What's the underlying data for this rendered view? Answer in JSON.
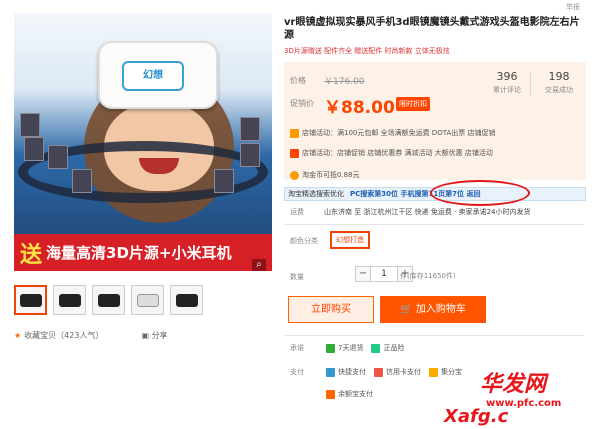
{
  "report_link": "举报",
  "product": {
    "title": "vr眼镜虚拟现实暴风手机3d眼镜魔镜头戴式游戏头盔电影院左右片源",
    "subtitle": "3D片源赠送 配件齐全 赠送配件 时尚新款 立体无极炫"
  },
  "image": {
    "headset_logo": "幻想",
    "promo_big": "送",
    "promo_text": "海量高清3D片源+小米耳机",
    "zoom_icon": "search-icon"
  },
  "thumbnails": [
    "thumb1",
    "thumb2",
    "thumb3",
    "thumb4",
    "thumb5"
  ],
  "favorite": {
    "label": "收藏宝贝（423人气）",
    "share": "分享"
  },
  "pricing": {
    "original_label": "价格",
    "original_price": "￥176.00",
    "promo_label": "促销价",
    "promo_price": "￥88.00",
    "badge": "限时折扣",
    "stats": [
      {
        "num": "396",
        "label": "累计评论"
      },
      {
        "num": "198",
        "label": "交易成功"
      }
    ]
  },
  "promotions": [
    {
      "label": "店铺活动：满100元包邮 全场满额免运费 DOTA出票 店铺促销",
      "color": "#f90"
    },
    {
      "label": "店铺活动：店铺促销 店铺优惠券 满减活动 大额优惠 店铺活动",
      "color": "#f40"
    }
  ],
  "coupon": "淘金币可抵0.88元",
  "rank_bar": {
    "left": "淘宝精选搜索优化",
    "highlight": "优化",
    "text": "PC搜索第30位 手机搜第11页第7位 返回",
    "tail": "返回"
  },
  "shipping": {
    "label": "运费",
    "text": "山东济南 至 浙江杭州江干区 快递 免运费 · 卖家承诺24小时内发货"
  },
  "attr": {
    "label": "颜色分类",
    "option": "幻想打造"
  },
  "quantity": {
    "label": "数量",
    "value": "1",
    "minus": "−",
    "plus": "+",
    "stock": "件(库存11650件)"
  },
  "buttons": {
    "buy": "立即购买",
    "cart": "加入购物车"
  },
  "services": [
    {
      "label": "承诺",
      "items": [
        {
          "text": "7天退货",
          "color": "#3a3"
        },
        {
          "text": "正品险",
          "color": "#2c8"
        }
      ]
    },
    {
      "label": "支付",
      "items": [
        {
          "text": "快捷支付",
          "color": "#39c"
        },
        {
          "text": "信用卡支付",
          "color": "#e54"
        },
        {
          "text": "集分宝",
          "color": "#fa0"
        }
      ]
    },
    {
      "label": "",
      "items": [
        {
          "text": "余额宝支付",
          "color": "#f60"
        }
      ]
    }
  ],
  "watermark": {
    "text": "华发网",
    "url": "www.pfc.com",
    "url2": "Xafg.c"
  }
}
